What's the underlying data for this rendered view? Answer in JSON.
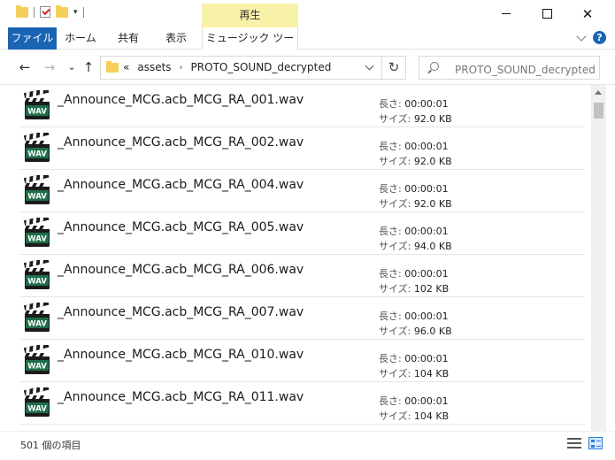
{
  "titlebar": {
    "context_tab": "再生",
    "minimize": "",
    "maximize": "",
    "close": "✕"
  },
  "ribbon": {
    "tabs": [
      {
        "label": "ファイル"
      },
      {
        "label": "ホーム"
      },
      {
        "label": "共有"
      },
      {
        "label": "表示"
      },
      {
        "label": "ミュージック ツール"
      }
    ],
    "help": "?"
  },
  "nav": {
    "back": "←",
    "forward": "→",
    "dropdown": "⌄",
    "up": "↑",
    "breadcrumb_overflow": "«",
    "path": [
      "assets",
      "PROTO_SOUND_decrypted"
    ],
    "separator": "›",
    "refresh": "↻",
    "search_placeholder": "PROTO_SOUND_decryptedの..."
  },
  "files": [
    {
      "name": "_Announce_MCG.acb_MCG_RA_001.wav",
      "length_label": "長さ:",
      "length": "00:00:01",
      "size_label": "サイズ:",
      "size": "92.0 KB"
    },
    {
      "name": "_Announce_MCG.acb_MCG_RA_002.wav",
      "length_label": "長さ:",
      "length": "00:00:01",
      "size_label": "サイズ:",
      "size": "92.0 KB"
    },
    {
      "name": "_Announce_MCG.acb_MCG_RA_004.wav",
      "length_label": "長さ:",
      "length": "00:00:01",
      "size_label": "サイズ:",
      "size": "92.0 KB"
    },
    {
      "name": "_Announce_MCG.acb_MCG_RA_005.wav",
      "length_label": "長さ:",
      "length": "00:00:01",
      "size_label": "サイズ:",
      "size": "94.0 KB"
    },
    {
      "name": "_Announce_MCG.acb_MCG_RA_006.wav",
      "length_label": "長さ:",
      "length": "00:00:01",
      "size_label": "サイズ:",
      "size": "102 KB"
    },
    {
      "name": "_Announce_MCG.acb_MCG_RA_007.wav",
      "length_label": "長さ:",
      "length": "00:00:01",
      "size_label": "サイズ:",
      "size": "96.0 KB"
    },
    {
      "name": "_Announce_MCG.acb_MCG_RA_010.wav",
      "length_label": "長さ:",
      "length": "00:00:01",
      "size_label": "サイズ:",
      "size": "104 KB"
    },
    {
      "name": "_Announce_MCG.acb_MCG_RA_011.wav",
      "length_label": "長さ:",
      "length": "00:00:01",
      "size_label": "サイズ:",
      "size": "104 KB"
    }
  ],
  "icons": {
    "wav_badge": "WAV"
  },
  "status": {
    "item_count": "501 個の項目"
  },
  "colors": {
    "file_tab": "#1a64b3",
    "context_tab": "#f8f1a8",
    "folder": "#f5cf5a",
    "wav_green": "#1f6e4a"
  }
}
